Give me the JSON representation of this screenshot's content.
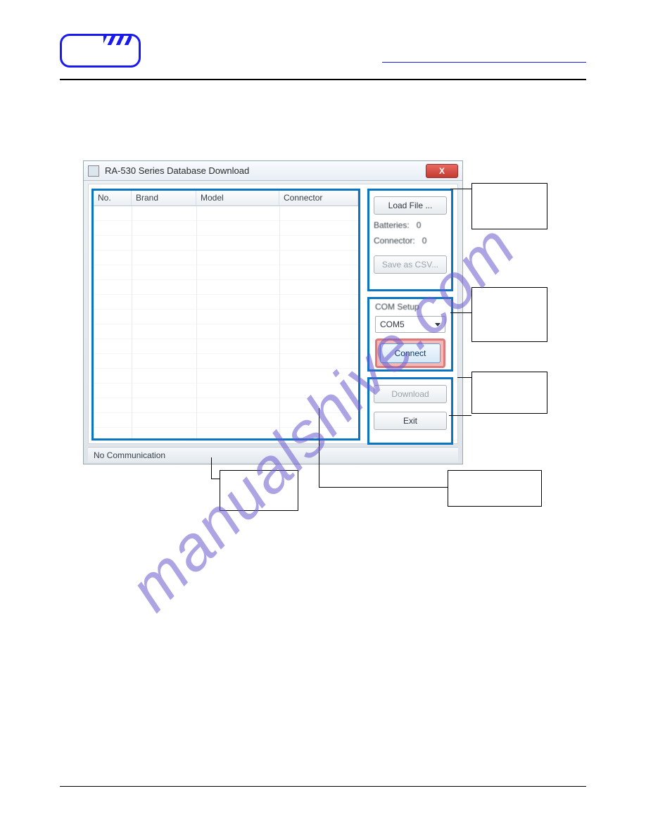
{
  "window": {
    "title": "RA-530 Series Database Download"
  },
  "grid": {
    "columns": {
      "no": "No.",
      "brand": "Brand",
      "model": "Model",
      "connector": "Connector"
    }
  },
  "load_panel": {
    "load_button": "Load File ...",
    "batteries_label": "Batteries:",
    "batteries_value": "0",
    "connector_label": "Connector:",
    "connector_value": "0",
    "save_csv_button": "Save as CSV..."
  },
  "com_panel": {
    "group_label": "COM Setup",
    "port_selected": "COM5",
    "connect_button": "Connect"
  },
  "dl_panel": {
    "download_button": "Download",
    "exit_button": "Exit"
  },
  "status": {
    "text": "No Communication"
  },
  "icons": {
    "close": "X"
  }
}
